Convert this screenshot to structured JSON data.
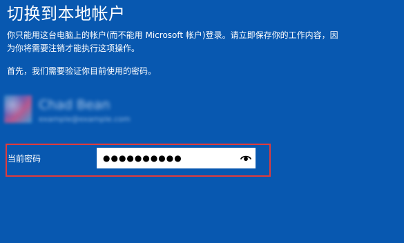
{
  "page": {
    "title": "切换到本地帐户",
    "description_line1": "你只能用这台电脑上的帐户(而不能用 Microsoft 帐户)登录。请立即保存你的工作内容，因",
    "description_line2": "为你将需要注销才能执行这项操作。",
    "verify_prompt": "首先，我们需要验证你目前使用的密码。"
  },
  "account": {
    "avatar": "user-avatar-blurred",
    "name": "Chad Bean",
    "email": "example@example.com"
  },
  "password_form": {
    "label": "当前密码",
    "value_mask": "●●●●●●●●●●",
    "reveal_icon": "eye-icon"
  },
  "colors": {
    "background": "#0858b0",
    "highlight_border": "#e23a3a",
    "text": "#ffffff",
    "field_bg": "#ffffff"
  }
}
